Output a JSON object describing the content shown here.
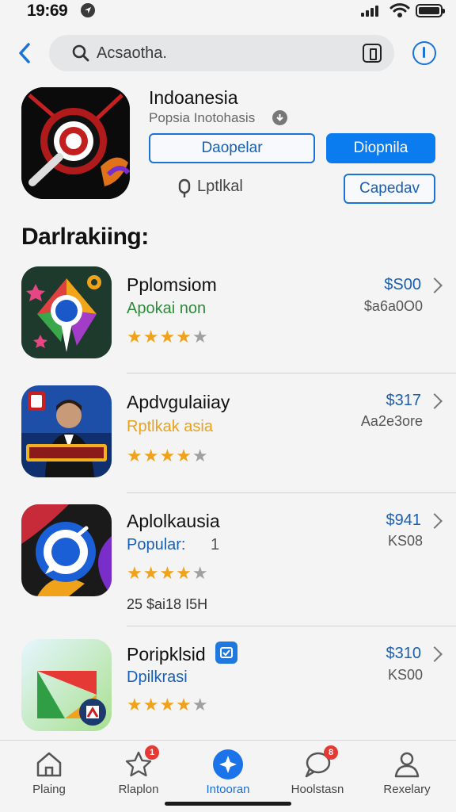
{
  "status_bar": {
    "time": "19:69"
  },
  "search": {
    "query": "Acsaotha."
  },
  "hero": {
    "title": "Indoanesia",
    "subtitle": "Popsia Inotohasis",
    "btn_outline": "Daopelar",
    "btn_filled": "Diopnila",
    "location_text": "Lptlkal",
    "btn_secondary": "Capedav"
  },
  "section": {
    "title": "Darlrakiing:"
  },
  "apps": [
    {
      "name": "Pplomsiom",
      "sub": "Apokai non",
      "sub_color": "#2e8b3a",
      "rating": 4,
      "price": "$S00",
      "size": "$a6a0O0"
    },
    {
      "name": "Apdvgulaiiay",
      "sub": "Rptlkak asia",
      "sub_color": "#e8a21e",
      "rating": 4,
      "price": "$317",
      "size": "Aa2e3ore"
    },
    {
      "name": "Aplolkausia",
      "sub": "Popular:",
      "sub_extra": "1",
      "sub_color": "#1a5fb0",
      "rating": 4,
      "price": "$941",
      "size": "KS08",
      "extra": "25  $ai18  I5H"
    },
    {
      "name": "Poripklsid",
      "sub": "Dpilkrasi",
      "sub_color": "#1a5fb0",
      "rating": 4,
      "price": "$310",
      "size": "KS00"
    }
  ],
  "tabs": [
    {
      "label": "Plaing",
      "active": false
    },
    {
      "label": "Rlaplon",
      "badge": "1",
      "active": false
    },
    {
      "label": "Intooran",
      "active": true
    },
    {
      "label": "Hoolstasn",
      "badge": "8",
      "active": false
    },
    {
      "label": "Rexelary",
      "active": false
    }
  ],
  "colors": {
    "accent": "#0a7cf0",
    "star": "#f0a21b",
    "badge": "#e53935"
  }
}
